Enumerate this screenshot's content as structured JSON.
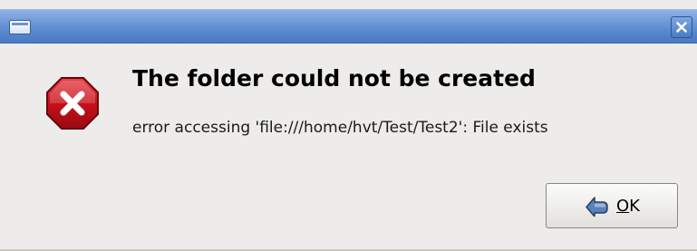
{
  "window": {
    "close_icon": "close-icon",
    "menu_icon": "window-menu-icon"
  },
  "dialog": {
    "icon": "error-icon",
    "title": "The folder could not be created",
    "message": "error accessing 'file:///home/hvt/Test/Test2': File exists"
  },
  "buttons": {
    "ok": {
      "icon": "ok-arrow-icon",
      "mnemonic": "O",
      "label_rest": "K"
    }
  },
  "colors": {
    "titlebar": "#5585cc",
    "background": "#edeceb",
    "error_red": "#c8101a"
  }
}
